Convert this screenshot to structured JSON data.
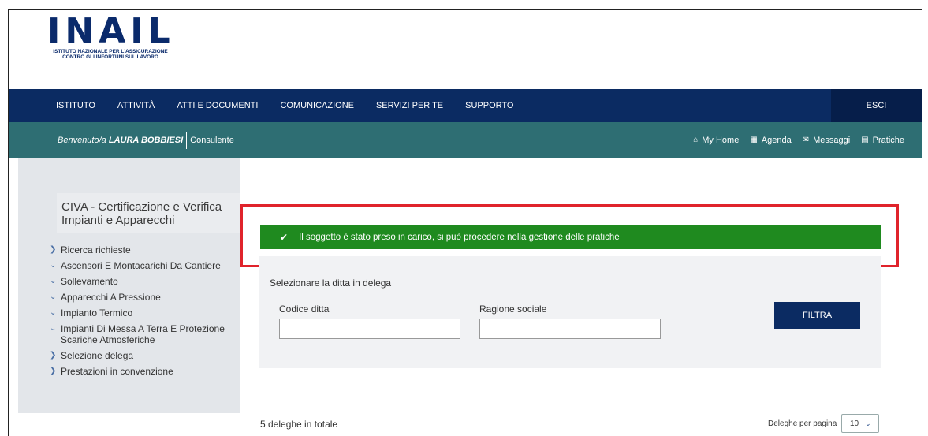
{
  "logo": {
    "mark": "INAIL",
    "subtitle_line1": "ISTITUTO NAZIONALE PER L'ASSICURAZIONE",
    "subtitle_line2": "CONTRO GLI INFORTUNI SUL LAVORO"
  },
  "topnav": {
    "items": [
      "ISTITUTO",
      "ATTIVITÀ",
      "ATTI E DOCUMENTI",
      "COMUNICAZIONE",
      "SERVIZI PER TE",
      "SUPPORTO"
    ],
    "esci": "ESCI",
    "color": "#0b2b62"
  },
  "subbar": {
    "welcome_prefix": "Benvenuto/a",
    "user_name": "LAURA BOBBIESI",
    "role": "Consulente",
    "links": [
      {
        "label": "My Home",
        "icon": "home-icon"
      },
      {
        "label": "Agenda",
        "icon": "calendar-icon"
      },
      {
        "label": "Messaggi",
        "icon": "envelope-icon"
      },
      {
        "label": "Pratiche",
        "icon": "folder-icon"
      }
    ],
    "color": "#2e6e73"
  },
  "sidebar": {
    "title": "CIVA - Certificazione e Verifica Impianti e Apparecchi",
    "items": [
      {
        "label": "Ricerca richieste",
        "chevron": "right"
      },
      {
        "label": "Ascensori E Montacarichi Da Cantiere",
        "chevron": "down"
      },
      {
        "label": "Sollevamento",
        "chevron": "down"
      },
      {
        "label": "Apparecchi A Pressione",
        "chevron": "down"
      },
      {
        "label": "Impianto Termico",
        "chevron": "down"
      },
      {
        "label": "Impianti Di Messa A Terra E Protezione Scariche Atmosferiche",
        "chevron": "down"
      },
      {
        "label": "Selezione delega",
        "chevron": "right"
      },
      {
        "label": "Prestazioni in convenzione",
        "chevron": "right"
      }
    ]
  },
  "alert": {
    "message": "Il soggetto è stato preso in carico, si può procedere nella gestione delle pratiche",
    "color": "#1f8a1f"
  },
  "filter_panel": {
    "title": "Selezionare la ditta in delega",
    "codice_label": "Codice ditta",
    "codice_value": "",
    "ragione_label": "Ragione sociale",
    "ragione_value": "",
    "button": "FILTRA"
  },
  "results": {
    "total_text": "5 deleghe in totale",
    "per_page_label": "Deleghe per pagina",
    "per_page_value": "10"
  }
}
